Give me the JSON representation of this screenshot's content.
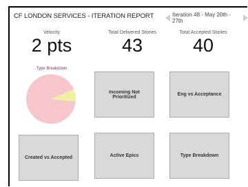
{
  "header": {
    "title": "CF LONDON SERVICES - ITERATION REPORT",
    "iteration": "Iteration 48 - May 20th - 27th"
  },
  "metrics": [
    {
      "label": "Velocity",
      "value": "2 pts"
    },
    {
      "label": "Total Delivered Stories",
      "value": "43"
    },
    {
      "label": "Total Accepted Stories",
      "value": "40"
    }
  ],
  "pie": {
    "title": "Type Breakdown",
    "slices": [
      {
        "share": 0.92,
        "color": "#f7c6cd"
      },
      {
        "share": 0.08,
        "color": "#eef0a2"
      }
    ]
  },
  "tiles": [
    "Incoming Not Prioritized",
    "Eng vs Acceptance",
    "Created vs Accepted",
    "Active Epics",
    "Type Breakdown"
  ]
}
